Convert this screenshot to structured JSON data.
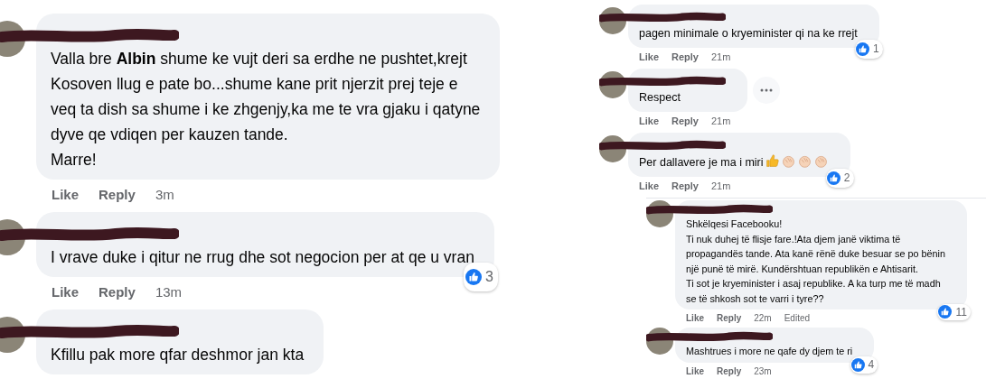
{
  "panels": [
    {
      "sections": [
        {
          "comments": [
            {
              "text": "Valla bre **Albin** shume ke vujt deri sa erdhe ne pushtet,krejt\nKosoven llug e pate bo...shume kane prit njerzit prej teje e\nveq ta dish sa shume i ke zhgenjy,ka me te vra gjaku i qatyne\ndyve qe vdiqen per kauzen tande.\nMarre!",
              "like": "Like",
              "reply": "Reply",
              "time": "3m"
            },
            {
              "text": "I vrave duke i qitur ne rrug dhe sot negocion per at qe u vran",
              "like": "Like",
              "reply": "Reply",
              "time": "13m",
              "reactions": "3"
            },
            {
              "text": "Kfillu pak more qfar deshmor jan kta"
            }
          ]
        }
      ]
    },
    {
      "sections": [
        {
          "comments": [
            {
              "text": "pagen minimale o kryeminister qi na ke rrejt",
              "like": "Like",
              "reply": "Reply",
              "time": "21m",
              "reactions": "1"
            },
            {
              "text": "Respect",
              "more_button": true,
              "like": "Like",
              "reply": "Reply",
              "time": "21m"
            },
            {
              "text": "Per dallavere je ma i miri",
              "trailing_icons": [
                {
                  "kind": "thumbs_up"
                },
                {
                  "kind": "clap"
                },
                {
                  "kind": "clap"
                },
                {
                  "kind": "clap"
                }
              ],
              "like": "Like",
              "reply": "Reply",
              "time": "21m",
              "reactions": "2"
            }
          ]
        },
        {
          "comments": [
            {
              "text": "Shkëlqesi Facebooku!\nTi nuk duhej të flisje fare.!Ata djem janë viktima të\npropagandës tande. Ata kanë rënë duke besuar se po bënin\nnjë punë të mirë. Kundërshtuan republikën e Ahtisarit.\nTi sot je kryeminister i asaj republike. A ka turp me të madh\nse të shkosh sot te varri i tyre??",
              "like": "Like",
              "reply": "Reply",
              "time": "22m",
              "edited": "Edited",
              "reactions": "11"
            },
            {
              "text": "Mashtrues i more ne qafe dy djem te ri",
              "like": "Like",
              "reply": "Reply",
              "time": "23m",
              "reactions": "4"
            }
          ]
        }
      ]
    }
  ]
}
